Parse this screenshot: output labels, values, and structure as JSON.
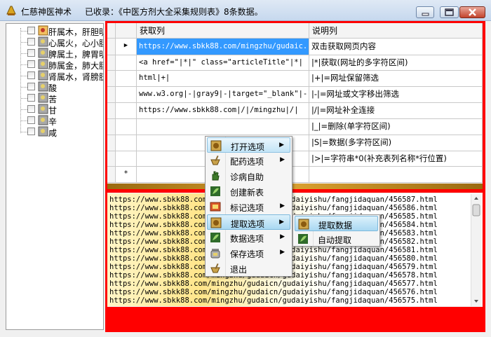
{
  "window": {
    "app_title": "仁慈神医神术",
    "info": "已收录：《中医方剂大全采集规则表》8条数据。"
  },
  "tree": {
    "items": [
      {
        "label": "肝属木，肝胆明"
      },
      {
        "label": "心属火，心小肠"
      },
      {
        "label": "脾属土，脾胃明"
      },
      {
        "label": "肺属金，肺大肠"
      },
      {
        "label": "肾属水，肾膀胱"
      },
      {
        "label": "酸"
      },
      {
        "label": "苦"
      },
      {
        "label": "甘"
      },
      {
        "label": "辛"
      },
      {
        "label": "咸"
      }
    ]
  },
  "grid": {
    "columns": [
      "获取列",
      "说明列"
    ],
    "rows": [
      {
        "get": "https://www.sbkk88.com/mingzhu/gudaic...",
        "desc": "双击获取网页内容"
      },
      {
        "get": "<a href=\"|*|\" class=\"articleTitle\"|*|",
        "desc": "|*|获取(网址的多字符区间)"
      },
      {
        "get": "html|+|",
        "desc": "|+|=网址保留筛选"
      },
      {
        "get": "www.w3.org|-|gray9|-|target=\"_blank\"|-|",
        "desc": "|-|=网址或文字移出筛选"
      },
      {
        "get": "https://www.sbkk88.com|/|/mingzhu|/|",
        "desc": "|/|=网址补全连接"
      },
      {
        "get": "",
        "desc": "|_|=删除(单字符区间)"
      },
      {
        "get": "",
        "desc": "|S|=数据(多字符区间)"
      },
      {
        "get": "",
        "desc": "|>|=字符串*0(补充表列名称*行位置)"
      }
    ],
    "current_row_marker": "▶",
    "new_row_marker": "*"
  },
  "urls": [
    "https://www.sbkk88.com/mingzhu/gudaicn/gudaiyishu/fangjidaquan/456587.html",
    "https://www.sbkk88.com/mingzhu/gudaicn/gudaiyishu/fangjidaquan/456586.html",
    "https://www.sbkk88.com/mingzhu/gudaicn/gudaiyishu/fangjidaquan/456585.html",
    "https://www.sbkk88.com/mingzhu/gudaicn/gudaiyishu/fangjidaquan/456584.html",
    "https://www.sbkk88.com/mingzhu/gudaicn/gudaiyishu/fangjidaquan/456583.html",
    "https://www.sbkk88.com/mingzhu/gudaicn/gudaiyishu/fangjidaquan/456582.html",
    "https://www.sbkk88.com/mingzhu/gudaicn/gudaiyishu/fangjidaquan/456581.html",
    "https://www.sbkk88.com/mingzhu/gudaicn/gudaiyishu/fangjidaquan/456580.html",
    "https://www.sbkk88.com/mingzhu/gudaicn/gudaiyishu/fangjidaquan/456579.html",
    "https://www.sbkk88.com/mingzhu/gudaicn/gudaiyishu/fangjidaquan/456578.html",
    "https://www.sbkk88.com/mingzhu/gudaicn/gudaiyishu/fangjidaquan/456577.html",
    "https://www.sbkk88.com/mingzhu/gudaicn/gudaiyishu/fangjidaquan/456576.html",
    "https://www.sbkk88.com/mingzhu/gudaicn/gudaiyishu/fangjidaquan/456575.html"
  ],
  "context_menu": {
    "items": [
      {
        "label": "打开选项",
        "icon": "herb-scroll-icon",
        "submenu": true
      },
      {
        "label": "配药选项",
        "icon": "mortar-icon",
        "submenu": true
      },
      {
        "label": "诊病自助",
        "icon": "hand-icon",
        "submenu": false
      },
      {
        "label": "创建新表",
        "icon": "green-leaf-icon",
        "submenu": false
      },
      {
        "label": "标记选项",
        "icon": "book-icon",
        "submenu": true
      },
      {
        "label": "提取选项",
        "icon": "herb-scroll-icon",
        "submenu": true
      },
      {
        "label": "数据选项",
        "icon": "green-leaf-icon",
        "submenu": true
      },
      {
        "label": "保存选项",
        "icon": "jar-icon",
        "submenu": true
      },
      {
        "label": "退出",
        "icon": "mortar-icon",
        "submenu": false
      }
    ]
  },
  "submenu": {
    "items": [
      {
        "label": "提取数据",
        "icon": "herb-scroll-icon"
      },
      {
        "label": "自动提取",
        "icon": "green-leaf-icon"
      }
    ]
  },
  "colors": {
    "frame": "#ff0000",
    "selection": "#3399ff"
  }
}
